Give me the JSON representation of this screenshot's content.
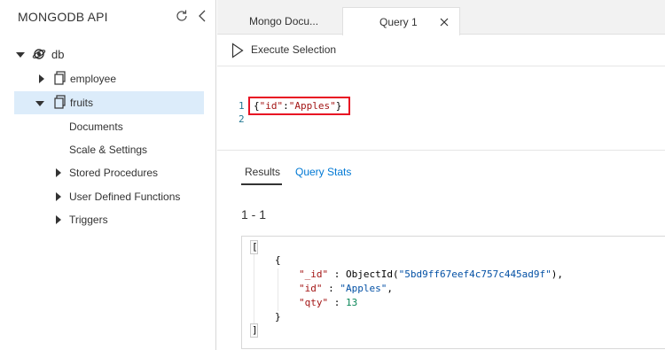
{
  "sidebar": {
    "title": "MONGODB API",
    "icons": {
      "refresh": "refresh-icon",
      "collapse": "chevron-left-icon"
    },
    "tree": {
      "db": "db",
      "employee": "employee",
      "fruits": "fruits",
      "children": {
        "documents": "Documents",
        "scale": "Scale & Settings",
        "stored": "Stored Procedures",
        "udf": "User Defined Functions",
        "triggers": "Triggers"
      }
    }
  },
  "tabs": {
    "mongo": "Mongo Docu...",
    "query": "Query 1"
  },
  "toolbar": {
    "execute": "Execute Selection"
  },
  "editor": {
    "line1": "1",
    "line2": "2",
    "code_open": "{",
    "code_key": "\"id\"",
    "code_colon": ":",
    "code_val": "\"Apples\"",
    "code_close": "}"
  },
  "results": {
    "tab_results": "Results",
    "tab_stats": "Query Stats",
    "count": "1 - 1",
    "json": {
      "open_bracket": "[",
      "open_brace": "{",
      "id_key": "\"_id\"",
      "id_sep": " : ",
      "id_fn": "ObjectId(",
      "id_val": "\"5bd9ff67eef4c757c445ad9f\"",
      "id_end": "),",
      "k_id": "\"id\"",
      "k_id_sep": " : ",
      "k_id_val": "\"Apples\"",
      "k_id_end": ",",
      "qty_key": "\"qty\"",
      "qty_sep": " : ",
      "qty_val": "13",
      "close_brace": "}",
      "close_bracket": "]"
    }
  },
  "colors": {
    "accent": "#0078d4",
    "selected_bg": "#dcecfa",
    "highlight_border": "#e81123"
  }
}
